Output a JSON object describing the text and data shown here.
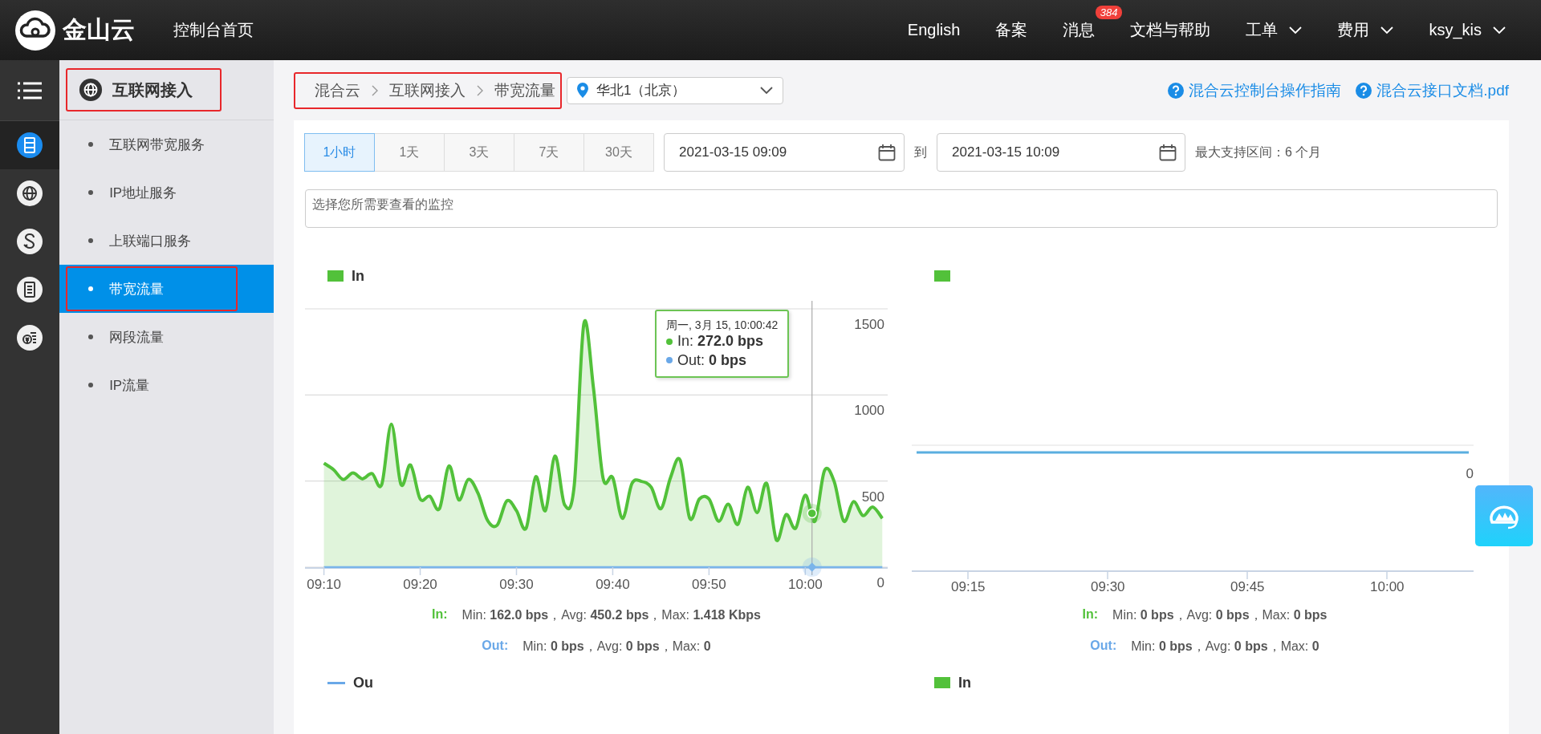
{
  "header": {
    "logo": "金山云",
    "home": "控制台首页",
    "nav": [
      {
        "label": "English",
        "dropdown": false
      },
      {
        "label": "备案",
        "dropdown": false
      },
      {
        "label": "消息",
        "badge": "384",
        "dropdown": false
      },
      {
        "label": "文档与帮助",
        "dropdown": false
      },
      {
        "label": "工单",
        "dropdown": true
      },
      {
        "label": "费用",
        "dropdown": true
      },
      {
        "label": "ksy_kis",
        "dropdown": true
      }
    ]
  },
  "rail": [
    {
      "kind": "server",
      "selected": true
    },
    {
      "kind": "globe",
      "selected": false
    },
    {
      "kind": "swap",
      "selected": false
    },
    {
      "kind": "list",
      "selected": false
    },
    {
      "kind": "billing",
      "selected": false
    }
  ],
  "sidebar": {
    "title": "互联网接入",
    "highlighted": true,
    "items": [
      {
        "label": "互联网带宽服务",
        "selected": false,
        "highlighted": false
      },
      {
        "label": "IP地址服务",
        "selected": false,
        "highlighted": false
      },
      {
        "label": "上联端口服务",
        "selected": false,
        "highlighted": false
      },
      {
        "label": "带宽流量",
        "selected": true,
        "highlighted": true
      },
      {
        "label": "网段流量",
        "selected": false,
        "highlighted": false
      },
      {
        "label": "IP流量",
        "selected": false,
        "highlighted": false
      }
    ]
  },
  "breadcrumb": {
    "items": [
      "混合云",
      "互联网接入",
      "带宽流量"
    ],
    "highlighted": true
  },
  "region": {
    "value": "华北1（北京）"
  },
  "links": [
    "混合云控制台操作指南",
    "混合云接口文档.pdf"
  ],
  "range_buttons": [
    {
      "label": "1小时",
      "selected": true
    },
    {
      "label": "1天",
      "selected": false
    },
    {
      "label": "3天",
      "selected": false
    },
    {
      "label": "7天",
      "selected": false
    },
    {
      "label": "30天",
      "selected": false
    }
  ],
  "date_from": "2021-03-15 09:09",
  "to_label": "到",
  "date_to": "2021-03-15 10:09",
  "range_note": "最大支持区间：6 个月",
  "monitor_select": {
    "placeholder": "选择您所需要查看的监控"
  },
  "left_chart": {
    "tooltip": {
      "title": "周一, 3月 15, 10:00:42",
      "separator": ":",
      "lines": [
        {
          "label": "In",
          "value": "**272.0 bps**",
          "color": "#52c13a"
        },
        {
          "label": "Out",
          "value": "**0 bps**",
          "color": "#6aa8e8"
        }
      ]
    },
    "stats": [
      {
        "label": "In:",
        "text": "Min: **162.0 bps**，Avg: **450.2 bps**，Max: **1.418 Kbps**",
        "color": "#52c13a"
      },
      {
        "label": "Out:",
        "text": "Min: **0 bps**，Avg: **0 bps**，Max: **0**",
        "color": "#6aa8e8"
      }
    ],
    "chart_data": {
      "type": "area",
      "categories": [
        "09:10",
        null,
        null,
        null,
        null,
        null,
        null,
        null,
        null,
        null,
        "09:20",
        null,
        null,
        null,
        null,
        null,
        null,
        null,
        null,
        null,
        "09:30",
        null,
        null,
        null,
        null,
        null,
        null,
        null,
        null,
        null,
        "09:40",
        null,
        null,
        null,
        null,
        null,
        null,
        null,
        null,
        null,
        "09:50",
        null,
        null,
        null,
        null,
        null,
        null,
        null,
        null,
        null,
        "10:00",
        null,
        null,
        null,
        null,
        null,
        null,
        null,
        null
      ],
      "series": [
        {
          "name": "In",
          "color": "#52c13a",
          "values": [
            604,
            566,
            509,
            547,
            513,
            543,
            480,
            830,
            480,
            593,
            396,
            412,
            339,
            588,
            391,
            509,
            430,
            271,
            244,
            385,
            328,
            226,
            525,
            328,
            645,
            362,
            475,
            1414,
            1041,
            516,
            520,
            283,
            486,
            498,
            464,
            339,
            520,
            622,
            283,
            396,
            396,
            267,
            366,
            249,
            464,
            317,
            486,
            158,
            305,
            226,
            418,
            267,
            561,
            498,
            267,
            380,
            299,
            350,
            283
          ]
        }
      ],
      "ylim": [
        0,
        1500
      ],
      "yticks": [
        0,
        500,
        1000,
        1500
      ]
    }
  },
  "right_chart": {
    "legend": [
      {
        "color": "#52c13a"
      }
    ],
    "y_label": "0",
    "x_labels": [
      "09:15",
      "09:30",
      "09:45",
      "10:00"
    ],
    "stats": [
      {
        "label": "In:",
        "text": "Min: **0 bps**，Avg: **0 bps**，Max: **0 bps**",
        "color": "#52c13a"
      },
      {
        "label": "Out:",
        "text": "Min: **0 bps**，Avg: **0 bps**，Max: **0**",
        "color": "#6aa8e8"
      }
    ]
  },
  "lower_legends": [
    {
      "label": "Ou",
      "kind": "line",
      "color": "#6aa8e8"
    },
    {
      "label": "In",
      "kind": "square",
      "color": "#52c13a"
    }
  ]
}
